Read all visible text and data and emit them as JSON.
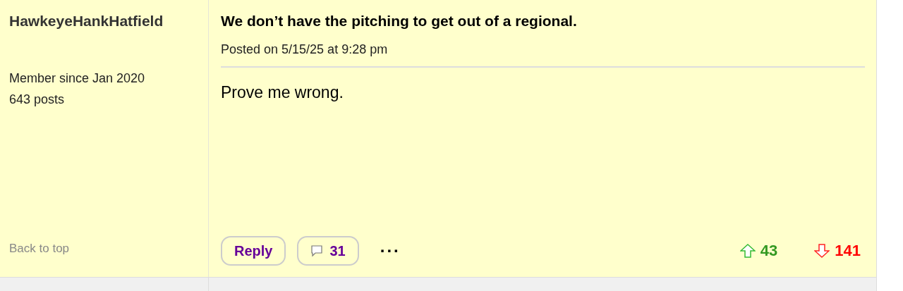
{
  "author": {
    "name": "HawkeyeHankHatfield",
    "member_since": "Member since Jan 2020",
    "posts": "643 posts",
    "back_to_top": "Back to top"
  },
  "post": {
    "title": "We don’t have the pitching to get out of a regional.",
    "posted": "Posted on 5/15/25 at 9:28 pm",
    "body": "Prove me wrong."
  },
  "actions": {
    "reply": "Reply",
    "comments": "31",
    "more": "..."
  },
  "votes": {
    "up": "43",
    "down": "141"
  }
}
